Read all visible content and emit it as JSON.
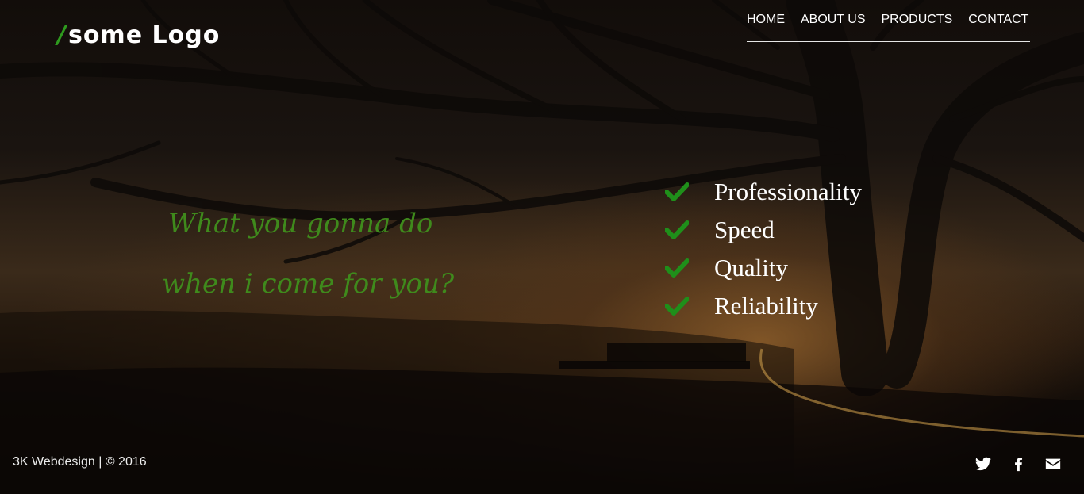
{
  "header": {
    "logo_slash": "/",
    "logo_text": "some Logo",
    "nav": [
      {
        "label": "HOME"
      },
      {
        "label": "ABOUT US"
      },
      {
        "label": "PRODUCTS"
      },
      {
        "label": "CONTACT"
      }
    ]
  },
  "hero": {
    "slogan_line1": "What you gonna do",
    "slogan_line2": "when i come for you?",
    "features": [
      {
        "label": "Professionality",
        "icon": "check-icon"
      },
      {
        "label": "Speed",
        "icon": "check-icon"
      },
      {
        "label": "Quality",
        "icon": "check-icon"
      },
      {
        "label": "Reliability",
        "icon": "check-icon"
      }
    ],
    "accent_color": "#2e9a1e"
  },
  "footer": {
    "copyright": "3K Webdesign | © 2016",
    "social": [
      {
        "icon": "twitter-icon"
      },
      {
        "icon": "facebook-icon"
      },
      {
        "icon": "email-icon"
      }
    ]
  }
}
